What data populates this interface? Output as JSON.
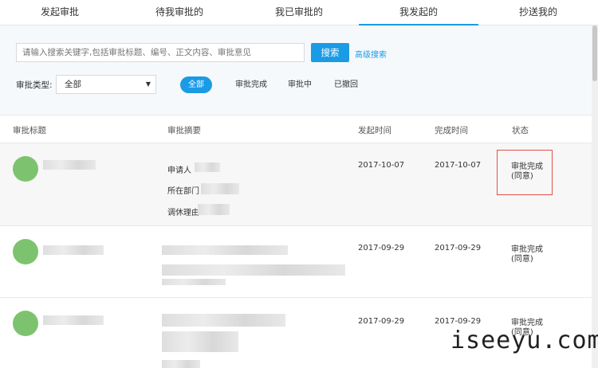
{
  "tabs": [
    {
      "label": "发起审批"
    },
    {
      "label": "待我审批的"
    },
    {
      "label": "我已审批的"
    },
    {
      "label": "我发起的",
      "active": true
    },
    {
      "label": "抄送我的"
    }
  ],
  "search": {
    "placeholder": "请输入搜索关键字,包括审批标题、编号、正文内容、审批意见",
    "button": "搜索",
    "advanced": "高级搜索"
  },
  "filter": {
    "type_label": "审批类型:",
    "type_value": "全部",
    "statuses": [
      {
        "label": "全部",
        "active": true
      },
      {
        "label": "审批完成"
      },
      {
        "label": "审批中"
      },
      {
        "label": "已撤回"
      }
    ]
  },
  "table": {
    "columns": [
      "审批标题",
      "审批摘要",
      "发起时间",
      "完成时间",
      "状态"
    ],
    "rows": [
      {
        "summary": [
          "申请人",
          "所在部门",
          "调休理由"
        ],
        "start": "2017-10-07",
        "end": "2017-10-07",
        "status": "审批完成",
        "result": "(同意)"
      },
      {
        "summary": [],
        "start": "2017-09-29",
        "end": "2017-09-29",
        "status": "审批完成",
        "result": "(同意)"
      },
      {
        "summary": [],
        "start": "2017-09-29",
        "end": "2017-09-29",
        "status": "审批完成",
        "result": "(同意)"
      }
    ]
  },
  "watermark": "iseeyu.com",
  "colors": {
    "accent": "#1a9be6",
    "avatar": "#7dc36f",
    "highlight": "#e0514a"
  }
}
